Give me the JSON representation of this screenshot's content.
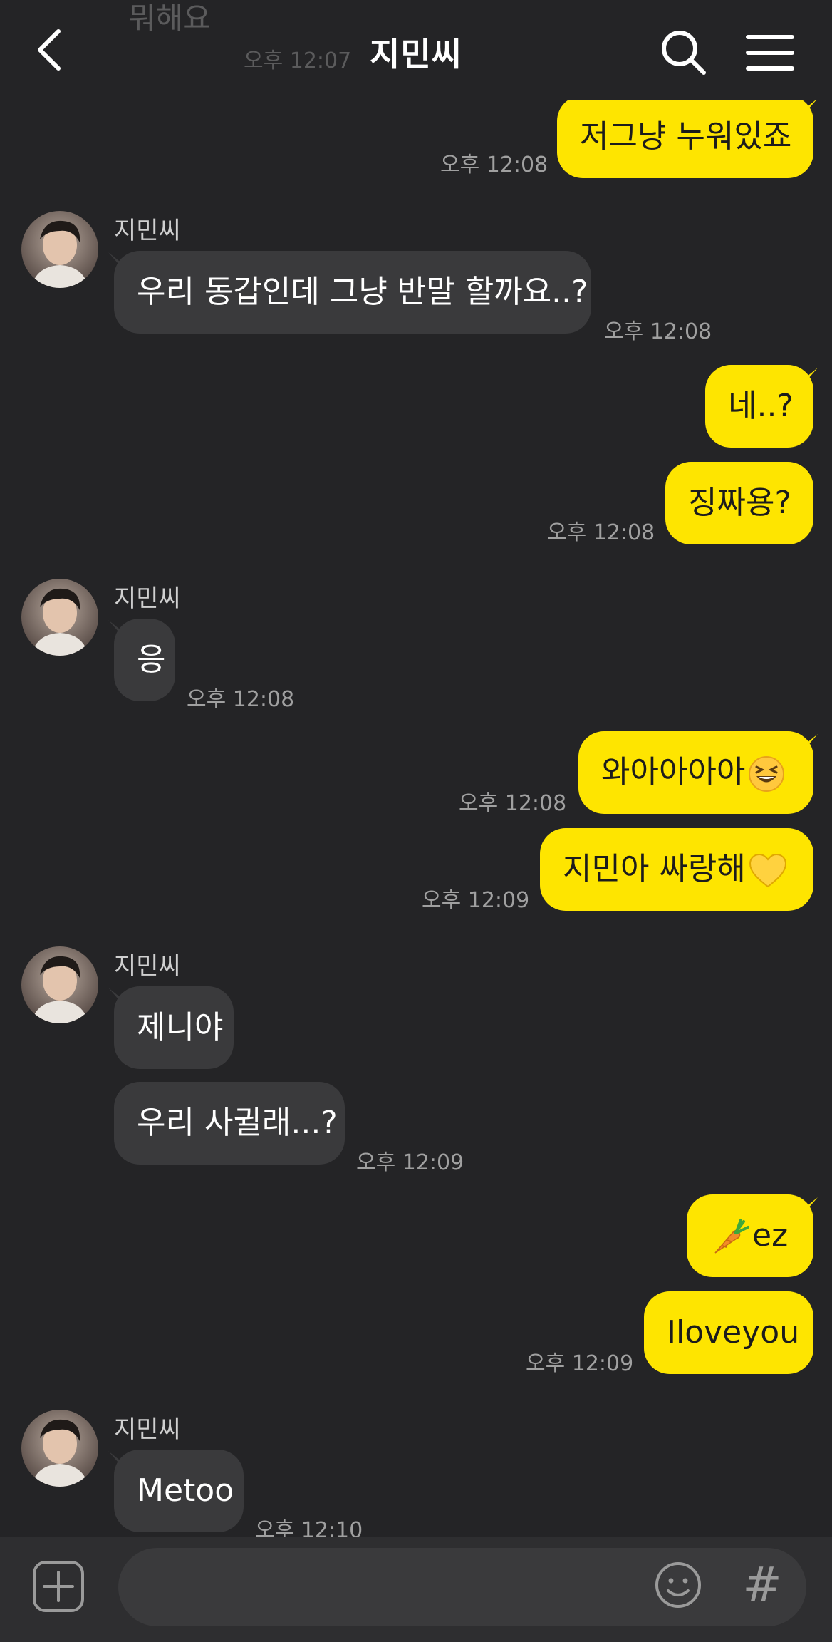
{
  "header": {
    "title": "지민씨",
    "back_icon": "chevron-left-icon",
    "search_icon": "search-icon",
    "menu_icon": "hamburger-menu-icon"
  },
  "ghost": {
    "prev_text": "뭐해요",
    "prev_time": "오후 12:07"
  },
  "contact": {
    "name": "지민씨"
  },
  "messages": [
    {
      "side": "out",
      "text": "저그냥 누워있죠",
      "time": "오후 12:08"
    },
    {
      "side": "in",
      "text": "우리 동갑인데 그냥 반말 할까요..?",
      "time": "오후 12:08"
    },
    {
      "side": "out",
      "text": "네..?"
    },
    {
      "side": "out",
      "text": "징짜용?",
      "time": "오후 12:08"
    },
    {
      "side": "in",
      "text": "응",
      "time": "오후 12:08"
    },
    {
      "side": "out",
      "text": "와아아아아",
      "emoji": "grinning-squinting-face",
      "time": "오후 12:08"
    },
    {
      "side": "out",
      "text": "지민아 싸랑해",
      "emoji": "yellow-heart",
      "time": "오후 12:09"
    },
    {
      "side": "in",
      "text": "제니야"
    },
    {
      "side": "in",
      "text": "우리 사귈래...?",
      "time": "오후 12:09"
    },
    {
      "side": "out",
      "text": "ez",
      "emoji": "carrot"
    },
    {
      "side": "out",
      "text": "Iloveyou",
      "time": "오후 12:09"
    },
    {
      "side": "in",
      "text": "Metoo",
      "time": "오후 12:10"
    }
  ],
  "input": {
    "placeholder": "",
    "value": "",
    "hash_label": "#"
  },
  "colors": {
    "background": "#242426",
    "outgoing_bubble": "#fee500",
    "incoming_bubble": "#3a3a3c"
  }
}
